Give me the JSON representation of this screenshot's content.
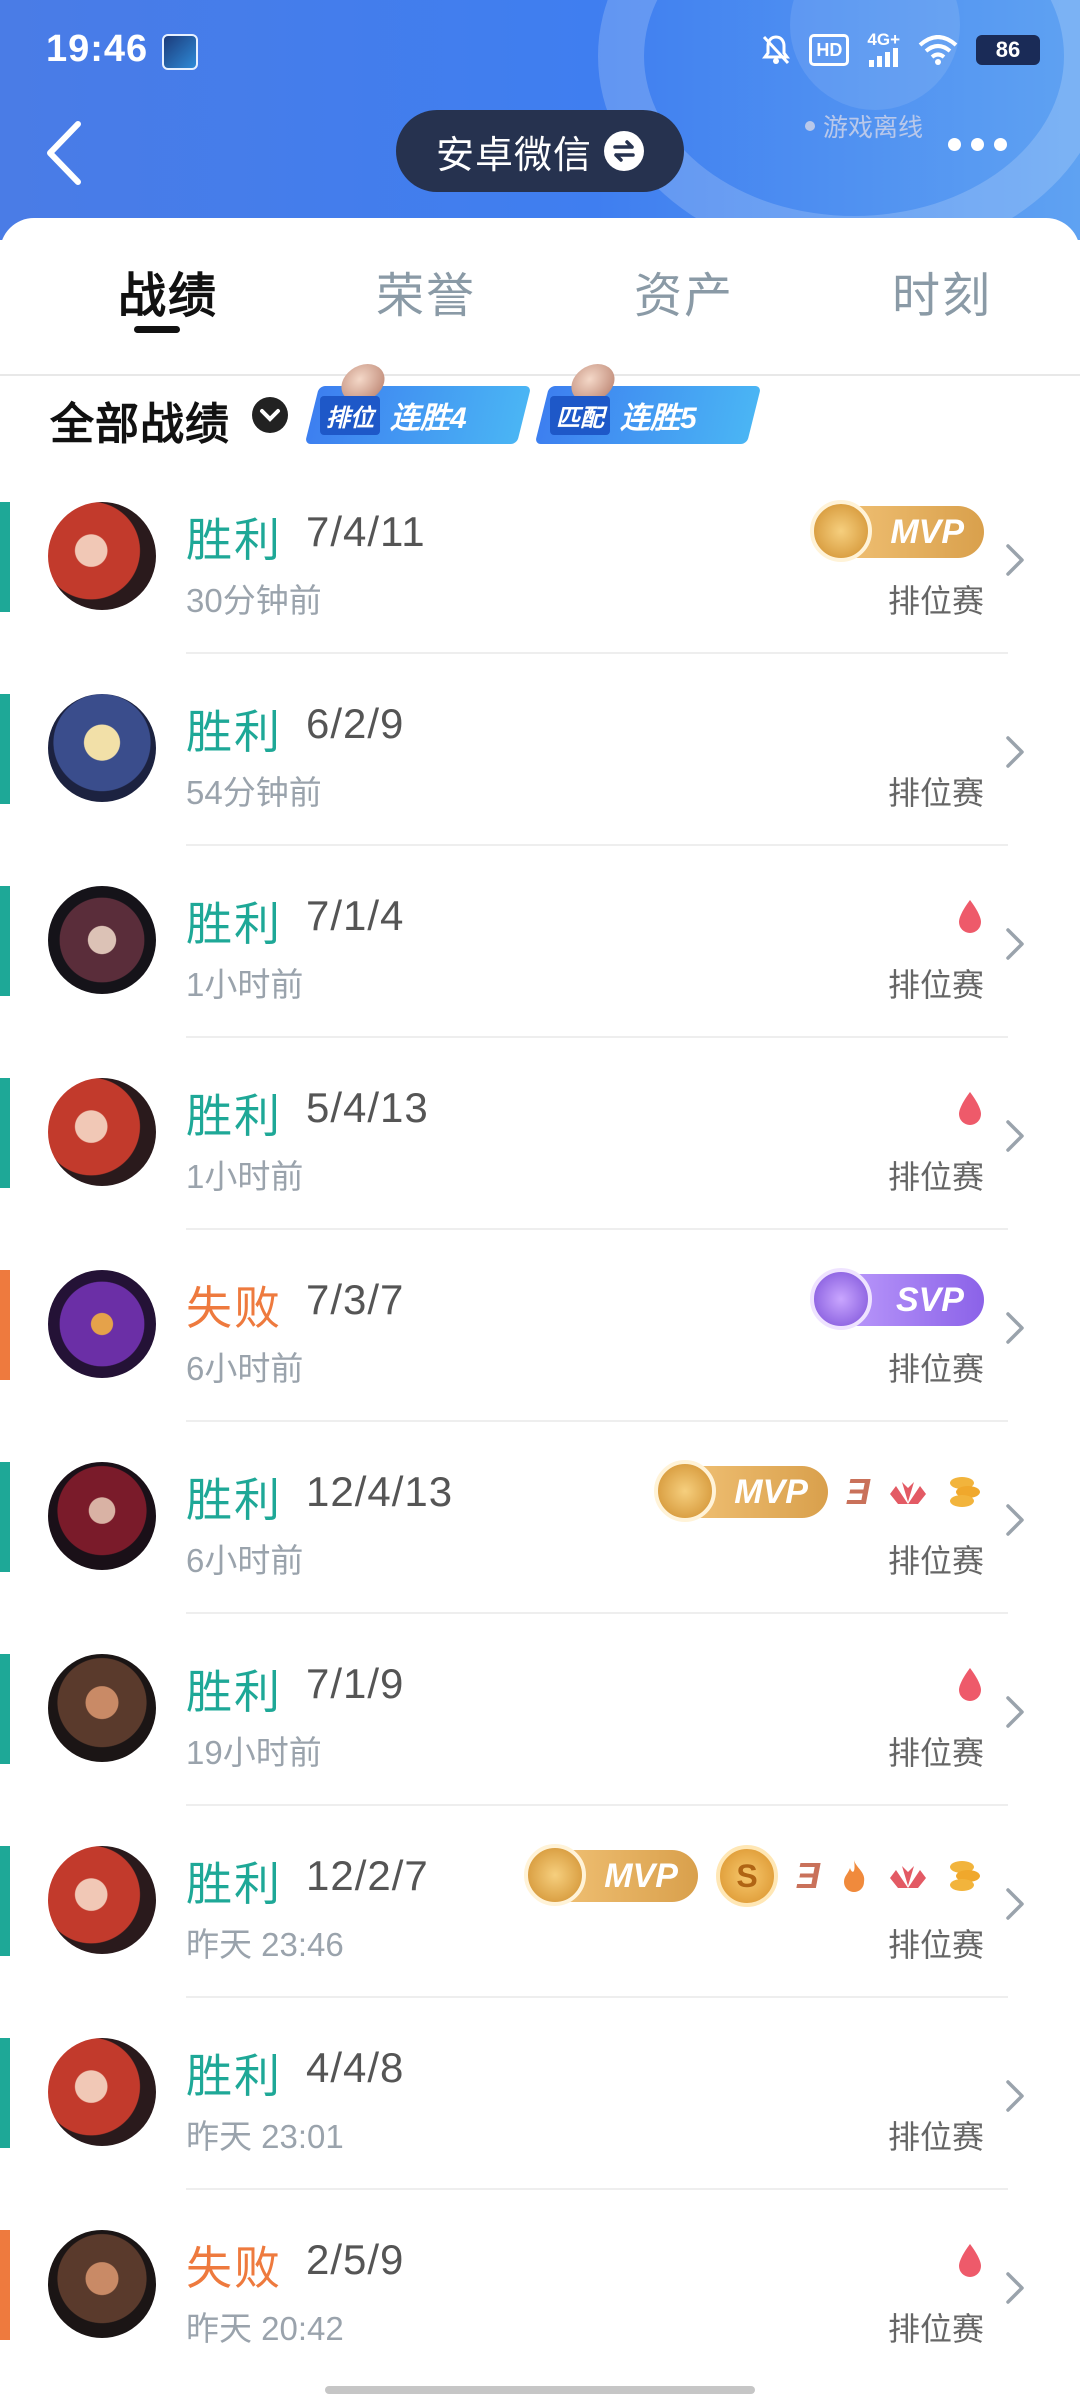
{
  "status_bar": {
    "time": "19:46",
    "battery": "86",
    "hd": "HD",
    "network": "4G+"
  },
  "header": {
    "account_label": "安卓微信",
    "offline_text": "游戏离线"
  },
  "tabs": [
    {
      "label": "战绩",
      "active": true
    },
    {
      "label": "荣誉",
      "active": false
    },
    {
      "label": "资产",
      "active": false
    },
    {
      "label": "时刻",
      "active": false
    }
  ],
  "filter": {
    "label": "全部战绩",
    "streaks": [
      {
        "kind": "排位",
        "text": "连胜4"
      },
      {
        "kind": "匹配",
        "text": "连胜5"
      }
    ]
  },
  "matches": [
    {
      "result": "胜利",
      "outcome": "win",
      "kda": "7/4/11",
      "time_ago": "30分钟前",
      "mode": "排位赛",
      "badge": "MVP",
      "extras": [],
      "hero_hue": "red"
    },
    {
      "result": "胜利",
      "outcome": "win",
      "kda": "6/2/9",
      "time_ago": "54分钟前",
      "mode": "排位赛",
      "badge": "",
      "extras": [],
      "hero_hue": "gold"
    },
    {
      "result": "胜利",
      "outcome": "win",
      "kda": "7/1/4",
      "time_ago": "1小时前",
      "mode": "排位赛",
      "badge": "",
      "extras": [
        "drop"
      ],
      "hero_hue": "dark"
    },
    {
      "result": "胜利",
      "outcome": "win",
      "kda": "5/4/13",
      "time_ago": "1小时前",
      "mode": "排位赛",
      "badge": "",
      "extras": [
        "drop"
      ],
      "hero_hue": "red"
    },
    {
      "result": "失败",
      "outcome": "loss",
      "kda": "7/3/7",
      "time_ago": "6小时前",
      "mode": "排位赛",
      "badge": "SVP",
      "extras": [],
      "hero_hue": "purple"
    },
    {
      "result": "胜利",
      "outcome": "win",
      "kda": "12/4/13",
      "time_ago": "6小时前",
      "mode": "排位赛",
      "badge": "MVP",
      "extras": [
        "triple",
        "wings",
        "coins"
      ],
      "hero_hue": "crimson"
    },
    {
      "result": "胜利",
      "outcome": "win",
      "kda": "7/1/9",
      "time_ago": "19小时前",
      "mode": "排位赛",
      "badge": "",
      "extras": [
        "drop"
      ],
      "hero_hue": "brown"
    },
    {
      "result": "胜利",
      "outcome": "win",
      "kda": "12/2/7",
      "time_ago": "昨天 23:46",
      "mode": "排位赛",
      "badge": "MVP",
      "extras": [
        "s-medal",
        "triple",
        "fire",
        "wings",
        "coins"
      ],
      "hero_hue": "red"
    },
    {
      "result": "胜利",
      "outcome": "win",
      "kda": "4/4/8",
      "time_ago": "昨天 23:01",
      "mode": "排位赛",
      "badge": "",
      "extras": [],
      "hero_hue": "red"
    },
    {
      "result": "失败",
      "outcome": "loss",
      "kda": "2/5/9",
      "time_ago": "昨天 20:42",
      "mode": "排位赛",
      "badge": "",
      "extras": [
        "drop"
      ],
      "hero_hue": "brown"
    }
  ],
  "icons": {
    "back": "chevron-left-icon",
    "swap": "swap-arrows-icon",
    "more": "more-dots-icon",
    "row_chevron": "chevron-right-icon",
    "filter_chevron": "chevron-down-circle-icon",
    "drop": "blood-drop-icon",
    "wings": "wings-icon",
    "coins": "coins-icon",
    "fire": "fire-icon"
  },
  "colors": {
    "header_blue": "#4a7ce6",
    "win": "#1ea897",
    "loss": "#ee7a3e",
    "mvp_gold": "#d9a04c",
    "svp_purple": "#8b62e8"
  }
}
